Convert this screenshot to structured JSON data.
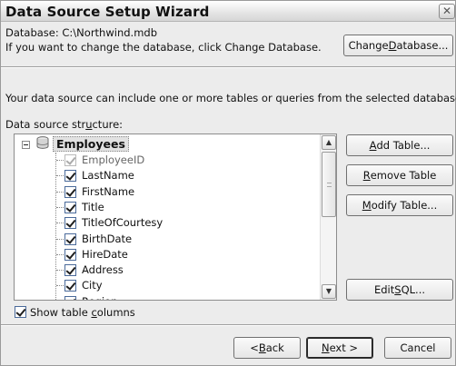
{
  "window": {
    "title": "Data Source Setup Wizard",
    "close_glyph": "✕"
  },
  "database": {
    "label": "Database: C:\\Northwind.mdb",
    "hint": "If you want to change the database, click Change Database.",
    "change_button": {
      "pre": "Change ",
      "mnemonic": "D",
      "post": "atabase..."
    }
  },
  "info_text": "Your data source can include one or more tables or queries from the selected database.",
  "structure": {
    "label_pre": "Data source str",
    "label_mnemonic": "u",
    "label_post": "cture:",
    "root": {
      "label": "Employees",
      "icon": "database-table-icon"
    },
    "columns": [
      {
        "name": "EmployeeID",
        "checked": true,
        "disabled": true
      },
      {
        "name": "LastName",
        "checked": true,
        "disabled": false
      },
      {
        "name": "FirstName",
        "checked": true,
        "disabled": false
      },
      {
        "name": "Title",
        "checked": true,
        "disabled": false
      },
      {
        "name": "TitleOfCourtesy",
        "checked": true,
        "disabled": false
      },
      {
        "name": "BirthDate",
        "checked": true,
        "disabled": false
      },
      {
        "name": "HireDate",
        "checked": true,
        "disabled": false
      },
      {
        "name": "Address",
        "checked": true,
        "disabled": false
      },
      {
        "name": "City",
        "checked": true,
        "disabled": false
      },
      {
        "name": "Region",
        "checked": true,
        "disabled": false
      }
    ]
  },
  "side_buttons": {
    "add_table": {
      "mnemonic": "A",
      "post": "dd Table..."
    },
    "remove_table": {
      "mnemonic": "R",
      "post": "emove Table"
    },
    "modify_table": {
      "mnemonic": "M",
      "post": "odify Table..."
    },
    "edit_sql": {
      "pre": "Edit ",
      "mnemonic": "S",
      "post": "QL..."
    }
  },
  "show_columns": {
    "pre": "Show table ",
    "mnemonic": "c",
    "post": "olumns",
    "checked": true
  },
  "footer": {
    "back": {
      "pre": "< ",
      "mnemonic": "B",
      "post": "ack"
    },
    "next": {
      "mnemonic": "N",
      "post": "ext >"
    },
    "cancel": "Cancel"
  },
  "colors": {
    "window_bg": "#ececec",
    "tree_bg": "#ffffff",
    "selection_bg": "#e2e2e2"
  }
}
